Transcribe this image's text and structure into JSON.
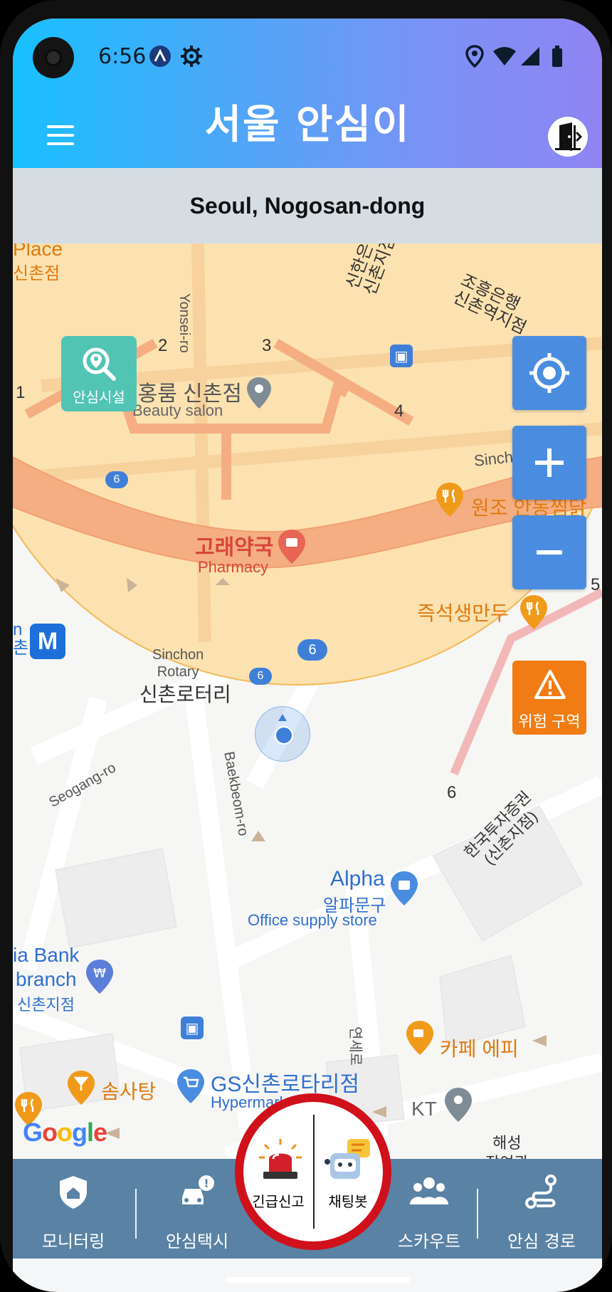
{
  "status_bar": {
    "time": "6:56"
  },
  "header": {
    "title": "서울 안심이"
  },
  "location": {
    "text": "Seoul, Nogosan-dong"
  },
  "map": {
    "buttons": {
      "safe_facility": "안심시설",
      "danger_zone": "위험 구역"
    },
    "labels": {
      "place_top": "Place",
      "place_top_kr": "신촌점",
      "sinhan_bank": "신한은행\n신촌지점",
      "johung": "조흥은행\n신촌역지점",
      "yonsei_ro": "Yonsei-ro",
      "beauty_kr": "서홍룸 신촌점",
      "beauty_en": "Beauty salon",
      "num1": "1",
      "num2": "2",
      "num3": "3",
      "num4": "4",
      "num5": "5",
      "num6": "6",
      "sinch": "Sinch",
      "wonjo": "원조 안동찜닭",
      "pharmacy_kr": "고래약국",
      "pharmacy_en": "Pharmacy",
      "mandu": "즉석생만두",
      "bus_num": "6",
      "rotary_en": "Sinchon\nRotary",
      "rotary_kr": "신촌로터리",
      "seogang_ro": "Seogang-ro",
      "baekbeom_ro": "Baekbeom-ro",
      "investment": "한국투자증권\n(신촌지점)",
      "alpha_en": "Alpha",
      "alpha_kr": "알파문구",
      "alpha_type": "Office supply store",
      "bank_line1": "ia Bank",
      "bank_line2": "branch",
      "bank_line3": "신촌지점",
      "cafe": "카페 에피",
      "yeonse_ro": "연세로",
      "somsatang": "솜사탕",
      "gs_kr": "GS신촌로타리점",
      "gs_en": "Hypermarket",
      "kt": "KT",
      "haesung": "해성\n장여관",
      "google": "Google",
      "metro_side": "n\n촌"
    }
  },
  "nav": {
    "items": [
      {
        "label": "모니터링",
        "icon": "shield-home-icon"
      },
      {
        "label": "안심택시",
        "icon": "taxi-alert-icon"
      },
      {
        "label": "스카우트",
        "icon": "people-group-icon"
      },
      {
        "label": "안심 경로",
        "icon": "route-icon"
      }
    ],
    "sos": {
      "label": "긴급신고"
    },
    "chatbot": {
      "label": "채팅봇"
    }
  },
  "colors": {
    "header_start": "#18c0ff",
    "header_end": "#8f84f3",
    "nav_bg": "#5a82a4",
    "sos_ring": "#d0101a",
    "danger": "#f07c13",
    "safe_facility": "#52c4b4",
    "map_control": "#4a8de0"
  }
}
